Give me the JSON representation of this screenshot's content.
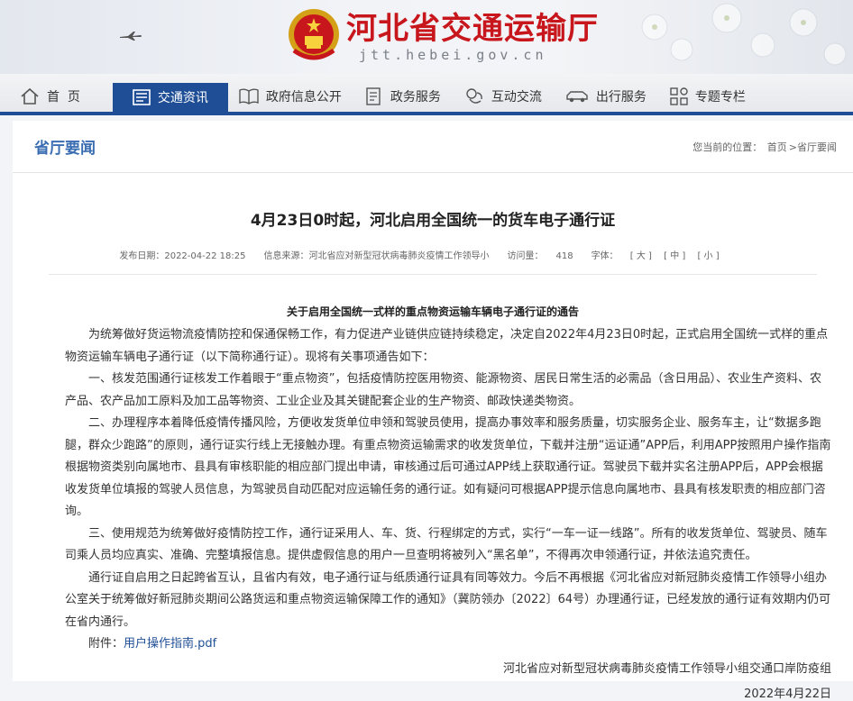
{
  "header": {
    "site_name": "河北省交通运输厅",
    "site_url": "jtt.hebei.gov.cn"
  },
  "nav": {
    "items": [
      {
        "label": "首  页",
        "icon": "home-icon"
      },
      {
        "label": "交通资讯",
        "icon": "news-icon",
        "active": true
      },
      {
        "label": "政府信息公开",
        "icon": "book-icon"
      },
      {
        "label": "政务服务",
        "icon": "document-icon"
      },
      {
        "label": "互动交流",
        "icon": "chat-icon"
      },
      {
        "label": "出行服务",
        "icon": "car-icon"
      },
      {
        "label": "专题专栏",
        "icon": "grid-icon"
      }
    ],
    "accent_color": "#1f4e96"
  },
  "section": {
    "title": "省厅要闻",
    "breadcrumb_prefix": "您当前的位置：",
    "breadcrumb_home": "首页",
    "breadcrumb_current": ">省厅要闻"
  },
  "article": {
    "title": "4月23日0时起，河北启用全国统一的货车电子通行证",
    "publish_label": "发布日期：",
    "publish_date": "2022-04-22 18:25",
    "source_label": "信息来源：",
    "source": "河北省应对新型冠状病毒肺炎疫情工作领导小",
    "visits_label": "访问量：",
    "visits": "418",
    "font_label": "字体：",
    "font_large": "[ 大 ]",
    "font_medium": "[ 中 ]",
    "font_small": "[ 小 ]",
    "doc_heading": "关于启用全国统一式样的重点物资运输车辆电子通行证的通告",
    "paragraphs": [
      "为统筹做好货运物流疫情防控和保通保畅工作，有力促进产业链供应链持续稳定，决定自2022年4月23日0时起，正式启用全国统一式样的重点物资运输车辆电子通行证（以下简称通行证）。现将有关事项通告如下：",
      "一、核发范围通行证核发工作着眼于“重点物资”，包括疫情防控医用物资、能源物资、居民日常生活的必需品（含日用品）、农业生产资料、农产品、农产品加工原料及加工品等物资、工业企业及其关键配套企业的生产物资、邮政快递类物资。",
      "二、办理程序本着降低疫情传播风险，方便收发货单位申领和驾驶员使用，提高办事效率和服务质量，切实服务企业、服务车主，让“数据多跑腿，群众少跑路”的原则，通行证实行线上无接触办理。有重点物资运输需求的收发货单位，下载并注册“运证通”APP后，利用APP按照用户操作指南根据物资类别向属地市、县具有审核职能的相应部门提出申请，审核通过后可通过APP线上获取通行证。驾驶员下载并实名注册APP后，APP会根据收发货单位填报的驾驶人员信息，为驾驶员自动匹配对应运输任务的通行证。如有疑问可根据APP提示信息向属地市、县具有核发职责的相应部门咨询。",
      "三、使用规范为统筹做好疫情防控工作，通行证采用人、车、货、行程绑定的方式，实行“一车一证一线路”。所有的收发货单位、驾驶员、随车司乘人员均应真实、准确、完整填报信息。提供虚假信息的用户一旦查明将被列入“黑名单”，不得再次申领通行证，并依法追究责任。",
      "通行证自启用之日起跨省互认，且省内有效，电子通行证与纸质通行证具有同等效力。今后不再根据《河北省应对新冠肺炎疫情工作领导小组办公室关于统筹做好新冠肺炎期间公路货运和重点物资运输保障工作的通知》（冀防领办〔2022〕64号）办理通行证，已经发放的通行证有效期内仍可在省内通行。"
    ],
    "attachment_label": "附件：",
    "attachment_link": "用户操作指南.pdf",
    "signature": "河北省应对新型冠状病毒肺炎疫情工作领导小组交通口岸防疫组",
    "date": "2022年4月22日"
  }
}
